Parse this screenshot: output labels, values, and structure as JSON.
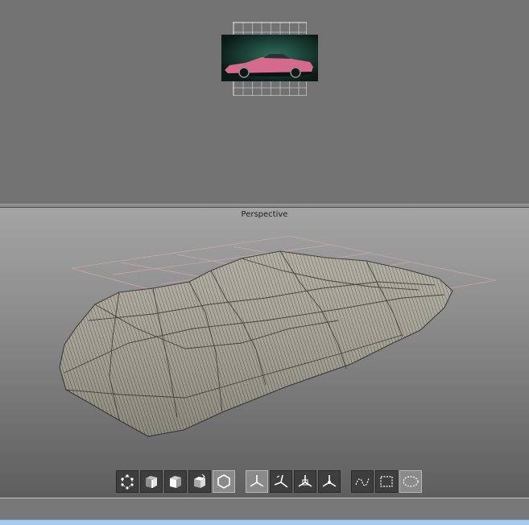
{
  "viewports": {
    "top": {
      "reference_image": "car-reference-image"
    },
    "perspective": {
      "label": "Perspective",
      "model": "car-mesh-wireframe"
    }
  },
  "toolbar": {
    "display_modes": [
      {
        "icon": "vertex-mode-icon"
      },
      {
        "icon": "edge-mode-icon"
      },
      {
        "icon": "face-mode-icon"
      },
      {
        "icon": "object-mode-icon"
      },
      {
        "icon": "hexagon-mode-icon",
        "active": true
      }
    ],
    "transform_modes": [
      {
        "icon": "axis-move-icon",
        "active": true
      },
      {
        "icon": "axis-rotate-icon"
      },
      {
        "icon": "axis-scale-icon"
      },
      {
        "icon": "axis-universal-icon"
      }
    ],
    "selection_modes": [
      {
        "icon": "lasso-select-icon"
      },
      {
        "icon": "rectangle-select-icon"
      },
      {
        "icon": "ellipse-select-icon",
        "active": true
      }
    ]
  },
  "colors": {
    "viewport_bg": "#727272",
    "mesh_fill": "#aaa79a",
    "mesh_wire": "#3c3b34",
    "status_bar": "#a9cbe8",
    "car_body": "#d46b8d"
  }
}
